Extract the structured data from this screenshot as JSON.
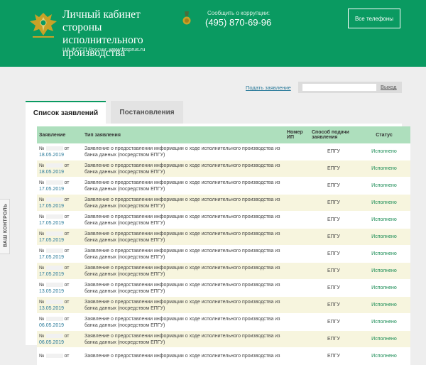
{
  "header": {
    "title": "Личный кабинет стороны исполнительного производства",
    "site_label": "ЦА ФССП России:",
    "site_url": "www.fssprus.ru",
    "corruption_label": "Сообщить о коррупции:",
    "corruption_phone": "(495) 870-69-96",
    "all_phones_label": "Все телефоны"
  },
  "side_tab": {
    "label": "ВАШ КОНТРОЛЬ"
  },
  "toolbar": {
    "submit_label": "Подать заявление",
    "user_name": "",
    "logout_label": "Выход"
  },
  "tabs": [
    {
      "label": "Список заявлений",
      "active": true
    },
    {
      "label": "Постановления",
      "active": false
    }
  ],
  "table": {
    "headers": {
      "application": "Заявление",
      "type": "Тип заявления",
      "ip_number": "Номер ИП",
      "channel": "Способ подачи заявления",
      "status": "Статус"
    },
    "rows": [
      {
        "no": "№",
        "from": "от",
        "date": "18.05.2019",
        "type": "Заявление о предоставлении информации о ходе исполнительного производства из банка данных (посредством ЕПГУ)",
        "ip_number": "",
        "channel": "ЕПГУ",
        "status": "Исполнено"
      },
      {
        "no": "№",
        "from": "от",
        "date": "18.05.2019",
        "type": "Заявление о предоставлении информации о ходе исполнительного производства из банка данных (посредством ЕПГУ)",
        "ip_number": "",
        "channel": "ЕПГУ",
        "status": "Исполнено"
      },
      {
        "no": "№",
        "from": "от",
        "date": "17.05.2019",
        "type": "Заявление о предоставлении информации о ходе исполнительного производства из банка данных (посредством ЕПГУ)",
        "ip_number": "",
        "channel": "ЕПГУ",
        "status": "Исполнено"
      },
      {
        "no": "№",
        "from": "от",
        "date": "17.05.2019",
        "type": "Заявление о предоставлении информации о ходе исполнительного производства из банка данных (посредством ЕПГУ)",
        "ip_number": "",
        "channel": "ЕПГУ",
        "status": "Исполнено"
      },
      {
        "no": "№",
        "from": "от",
        "date": "17.05.2019",
        "type": "Заявление о предоставлении информации о ходе исполнительного производства из банка данных (посредством ЕПГУ)",
        "ip_number": "",
        "channel": "ЕПГУ",
        "status": "Исполнено"
      },
      {
        "no": "№",
        "from": "от",
        "date": "17.05.2019",
        "type": "Заявление о предоставлении информации о ходе исполнительного производства из банка данных (посредством ЕПГУ)",
        "ip_number": "",
        "channel": "ЕПГУ",
        "status": "Исполнено"
      },
      {
        "no": "№",
        "from": "от",
        "date": "17.05.2019",
        "type": "Заявление о предоставлении информации о ходе исполнительного производства из банка данных (посредством ЕПГУ)",
        "ip_number": "",
        "channel": "ЕПГУ",
        "status": "Исполнено"
      },
      {
        "no": "№",
        "from": "от",
        "date": "17.05.2019",
        "type": "Заявление о предоставлении информации о ходе исполнительного производства из банка данных (посредством ЕПГУ)",
        "ip_number": "",
        "channel": "ЕПГУ",
        "status": "Исполнено"
      },
      {
        "no": "№",
        "from": "от",
        "date": "13.05.2019",
        "type": "Заявление о предоставлении информации о ходе исполнительного производства из банка данных (посредством ЕПГУ)",
        "ip_number": "",
        "channel": "ЕПГУ",
        "status": "Исполнено"
      },
      {
        "no": "№",
        "from": "от",
        "date": "13.05.2019",
        "type": "Заявление о предоставлении информации о ходе исполнительного производства из банка данных (посредством ЕПГУ)",
        "ip_number": "",
        "channel": "ЕПГУ",
        "status": "Исполнено"
      },
      {
        "no": "№",
        "from": "от",
        "date": "06.05.2019",
        "type": "Заявление о предоставлении информации о ходе исполнительного производства из банка данных (посредством ЕПГУ)",
        "ip_number": "",
        "channel": "ЕПГУ",
        "status": "Исполнено"
      },
      {
        "no": "№",
        "from": "от",
        "date": "06.05.2019",
        "type": "Заявление о предоставлении информации о ходе исполнительного производства из банка данных (посредством ЕПГУ)",
        "ip_number": "",
        "channel": "ЕПГУ",
        "status": "Исполнено"
      },
      {
        "no": "№",
        "from": "от",
        "date": "",
        "type": "Заявление о предоставлении информации о ходе исполнительного производства из",
        "ip_number": "",
        "channel": "ЕПГУ",
        "status": "Исполнено"
      }
    ]
  },
  "colors": {
    "header_bg": "#0a9a61",
    "table_header_bg": "#aedfbd",
    "row_alt_bg": "#f7f5de",
    "status_color": "#1a8c55",
    "link_color": "#2a7a9a"
  },
  "icons": {
    "logo": "fssp-emblem-icon",
    "medal": "medal-icon"
  }
}
